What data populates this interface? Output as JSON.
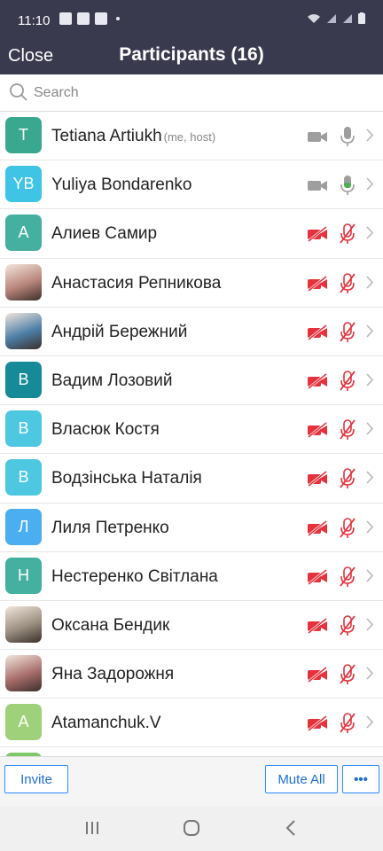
{
  "status": {
    "time": "11:10"
  },
  "header": {
    "close_label": "Close",
    "title": "Participants (16)"
  },
  "search": {
    "placeholder": "Search"
  },
  "participants": [
    {
      "initials": "T",
      "name": "Tetiana Artiukh",
      "tag": "(me, host)",
      "color": "#3aa88f",
      "video": "off-gray",
      "mic": "gray"
    },
    {
      "initials": "YB",
      "name": "Yuliya Bondarenko",
      "tag": "",
      "color": "#3fc4e6",
      "video": "off-gray",
      "mic": "green"
    },
    {
      "initials": "A",
      "name": "Алиев Самир",
      "tag": "",
      "color": "#45b09f",
      "video": "muted",
      "mic": "muted"
    },
    {
      "initials": "",
      "name": "Анастасия Репникова",
      "tag": "",
      "color": "#b9857b",
      "photo": true,
      "video": "muted",
      "mic": "muted"
    },
    {
      "initials": "",
      "name": "Андрій Бережний",
      "tag": "",
      "color": "#4d7fa8",
      "photo": true,
      "video": "muted",
      "mic": "muted"
    },
    {
      "initials": "В",
      "name": "Вадим Лозовий",
      "tag": "",
      "color": "#168b97",
      "video": "muted",
      "mic": "muted"
    },
    {
      "initials": "В",
      "name": "Власюк Костя",
      "tag": "",
      "color": "#4ec8e0",
      "video": "muted",
      "mic": "muted"
    },
    {
      "initials": "В",
      "name": "Водзінська Наталія",
      "tag": "",
      "color": "#4ec8e0",
      "video": "muted",
      "mic": "muted"
    },
    {
      "initials": "Л",
      "name": "Лиля Петренко",
      "tag": "",
      "color": "#4aaef0",
      "video": "muted",
      "mic": "muted"
    },
    {
      "initials": "Н",
      "name": "Нестеренко Світлана",
      "tag": "",
      "color": "#45b09f",
      "video": "muted",
      "mic": "muted"
    },
    {
      "initials": "",
      "name": "Оксана Бендик",
      "tag": "",
      "color": "#9a8f80",
      "photo": true,
      "video": "muted",
      "mic": "muted"
    },
    {
      "initials": "",
      "name": "Яна Задорожня",
      "tag": "",
      "color": "#a86d6b",
      "photo": true,
      "video": "muted",
      "mic": "muted"
    },
    {
      "initials": "A",
      "name": "Atamanchuk.V",
      "tag": "",
      "color": "#9fd07a",
      "video": "muted",
      "mic": "muted"
    },
    {
      "initials": "",
      "name": "",
      "tag": "",
      "color": "#7ec86a",
      "video": "muted",
      "mic": "muted"
    }
  ],
  "footer": {
    "invite_label": "Invite",
    "mute_all_label": "Mute All",
    "more_label": "•••"
  },
  "colors": {
    "header": "#3a3a4e",
    "accent": "#2d8cff",
    "muted_red": "#e5323c",
    "mic_green": "#4caf50",
    "icon_gray": "#9e9e9e"
  }
}
